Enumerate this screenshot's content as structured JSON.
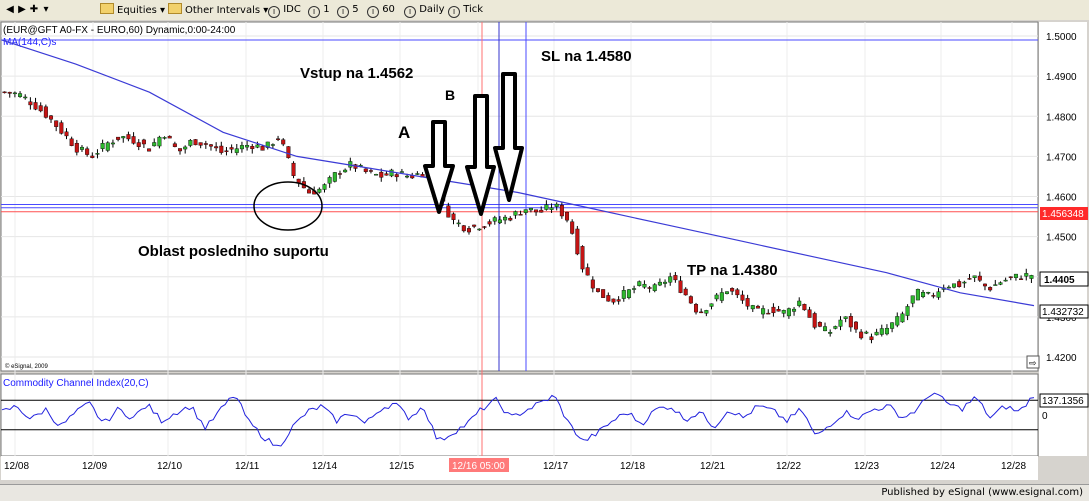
{
  "toolbar": {
    "items": [
      "Equities",
      "Other Intervals",
      "IDC",
      "1",
      "5",
      "60",
      "Daily",
      "Tick"
    ]
  },
  "chart_header": "(EUR@GFT A0-FX - EURO,60) Dynamic,0:00-24:00",
  "ma_label": "MA(144,C)s",
  "copyright": "© eSignal, 2009",
  "footer": "Published by eSignal (www.esignal.com)",
  "annotations": {
    "vstup": "Vstup na 1.4562",
    "sl": "SL na 1.4580",
    "tp": "TP na 1.4380",
    "oblast": "Oblast posledniho suportu",
    "a": "A",
    "b": "B"
  },
  "chart_data": [
    {
      "type": "candlestick",
      "title": "(EUR@GFT A0-FX - EURO,60) Dynamic,0:00-24:00",
      "instrument": "EUR@GFT A0-FX",
      "interval": "60",
      "x_tick_labels": [
        "12/08",
        "12/09",
        "12/10",
        "12/11",
        "12/14",
        "12/15",
        "12/16 05:00",
        "12/17",
        "12/18",
        "12/21",
        "12/22",
        "12/23",
        "12/24",
        "12/28"
      ],
      "y_tick_labels": [
        "1.5000",
        "1.4900",
        "1.4800",
        "1.4700",
        "1.4600",
        "1.4500",
        "1.4400",
        "1.4300",
        "1.4200"
      ],
      "ylim": [
        1.4165,
        1.5035
      ],
      "price_labels": [
        "1.456348",
        "1.4405",
        "1.432732"
      ],
      "levels": {
        "entry": 1.4562,
        "stop_loss": 1.458,
        "take_profit": 1.438,
        "upper": 1.499
      },
      "close_series": [
        1.486,
        1.4855,
        1.483,
        1.48,
        1.476,
        1.472,
        1.47,
        1.473,
        1.475,
        1.474,
        1.472,
        1.476,
        1.471,
        1.474,
        1.473,
        1.471,
        1.472,
        1.473,
        1.472,
        1.475,
        1.465,
        1.461,
        1.462,
        1.466,
        1.468,
        1.466,
        1.465,
        1.466,
        1.465,
        1.466,
        1.46,
        1.454,
        1.452,
        1.453,
        1.454,
        1.455,
        1.457,
        1.456,
        1.458,
        1.454,
        1.442,
        1.436,
        1.434,
        1.436,
        1.438,
        1.437,
        1.44,
        1.436,
        1.431,
        1.434,
        1.437,
        1.434,
        1.431,
        1.432,
        1.431,
        1.434,
        1.428,
        1.426,
        1.43,
        1.426,
        1.425,
        1.427,
        1.43,
        1.436,
        1.435,
        1.438,
        1.438,
        1.44,
        1.437,
        1.439,
        1.44,
        1.4405
      ],
      "ma": {
        "name": "MA(144,C)s",
        "values": [
          1.499,
          1.493,
          1.486,
          1.476,
          1.47,
          1.467,
          1.464,
          1.461,
          1.457,
          1.453,
          1.449,
          1.445,
          1.441,
          1.436,
          1.4328
        ]
      },
      "marks": {
        "x_labels": [
          "12/16 05:00"
        ]
      }
    },
    {
      "type": "line",
      "title": "Commodity Channel Index(20,C)",
      "series": [
        {
          "name": "Commodity Channel Index(20,C)",
          "last": "137.1356"
        }
      ],
      "y_tick_labels": [
        "0"
      ],
      "ylim": [
        -250,
        250
      ],
      "reference_lines": [
        100,
        0,
        -100
      ],
      "values": [
        20,
        60,
        -30,
        40,
        -80,
        10,
        80,
        -60,
        40,
        -20,
        70,
        -40,
        20,
        60,
        -90,
        30,
        140,
        -50,
        -150,
        -220,
        -80,
        20,
        60,
        -40,
        20,
        -60,
        40,
        80,
        -20,
        60,
        -180,
        -120,
        -60,
        40,
        100,
        -20,
        30,
        80,
        130,
        -60,
        -180,
        -120,
        -40,
        20,
        -60,
        40,
        60,
        -30,
        20,
        -80,
        40,
        -20,
        60,
        30,
        -40,
        40,
        -150,
        -60,
        20,
        -20,
        40,
        60,
        -20,
        40,
        160,
        80,
        40,
        120,
        -20,
        60,
        20,
        137
      ]
    }
  ]
}
